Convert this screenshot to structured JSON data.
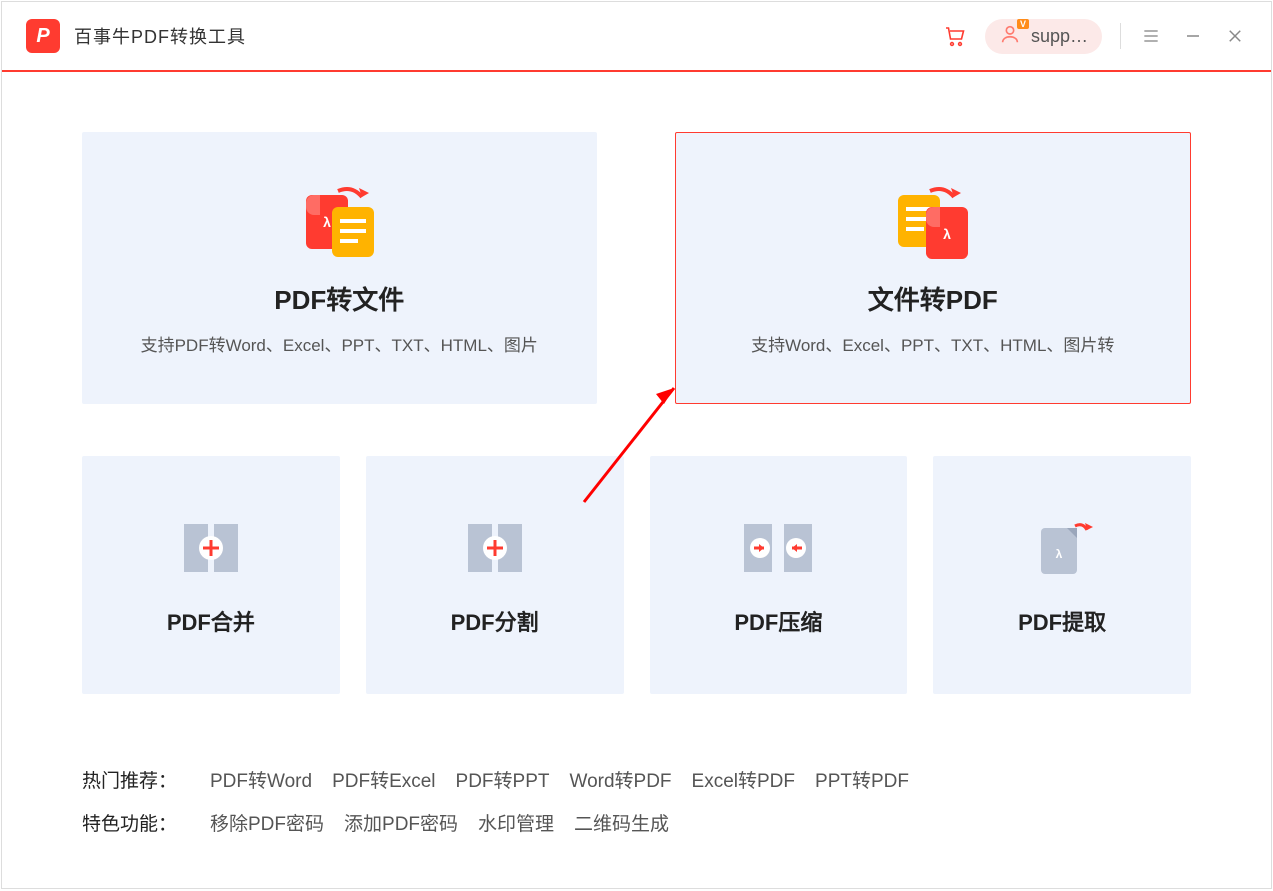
{
  "header": {
    "app_title": "百事牛PDF转换工具",
    "logo_letter": "P",
    "user_label": "supp…"
  },
  "main_cards": [
    {
      "title": "PDF转文件",
      "desc": "支持PDF转Word、Excel、PPT、TXT、HTML、图片",
      "selected": false
    },
    {
      "title": "文件转PDF",
      "desc": "支持Word、Excel、PPT、TXT、HTML、图片转",
      "selected": true
    }
  ],
  "tool_cards": [
    {
      "title": "PDF合并"
    },
    {
      "title": "PDF分割"
    },
    {
      "title": "PDF压缩"
    },
    {
      "title": "PDF提取"
    }
  ],
  "footer": {
    "hot_label": "热门推荐：",
    "hot_links": [
      "PDF转Word",
      "PDF转Excel",
      "PDF转PPT",
      "Word转PDF",
      "Excel转PDF",
      "PPT转PDF"
    ],
    "feat_label": "特色功能：",
    "feat_links": [
      "移除PDF密码",
      "添加PDF密码",
      "水印管理",
      "二维码生成"
    ]
  }
}
